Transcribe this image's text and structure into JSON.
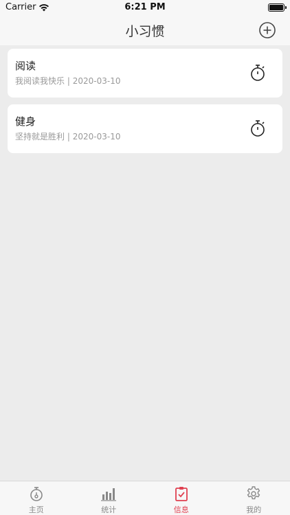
{
  "status_bar": {
    "carrier": "Carrier",
    "time": "6:21 PM"
  },
  "nav": {
    "title": "小习惯",
    "add_icon": "add-circle-icon"
  },
  "habits": [
    {
      "name": "阅读",
      "motto": "我阅读我快乐",
      "separator": "|",
      "date": "2020-03-10"
    },
    {
      "name": "健身",
      "motto": "坚持就是胜利",
      "separator": "|",
      "date": "2020-03-10"
    }
  ],
  "tabs": [
    {
      "label": "主页",
      "icon": "stopwatch-icon",
      "active": false
    },
    {
      "label": "统计",
      "icon": "bar-chart-icon",
      "active": false
    },
    {
      "label": "信息",
      "icon": "clipboard-check-icon",
      "active": true
    },
    {
      "label": "我的",
      "icon": "gear-icon",
      "active": false
    }
  ],
  "colors": {
    "accent": "#e04050",
    "background": "#ececec",
    "card": "#ffffff",
    "inactive": "#888888"
  }
}
